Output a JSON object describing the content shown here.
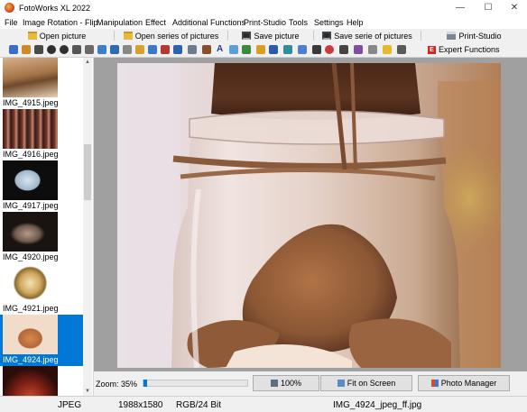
{
  "window": {
    "title": "FotoWorks XL 2022",
    "controls": [
      "—",
      "☐",
      "✕"
    ]
  },
  "menu": [
    "File",
    "Image Rotation - Flip",
    "Manipulation",
    "Effect",
    "Additional Functions",
    "Print-Studio",
    "Tools",
    "Settings",
    "Help"
  ],
  "main_toolbar": {
    "open_picture": "Open picture",
    "open_series": "Open series of pictures",
    "save_picture": "Save picture",
    "save_series": "Save serie of pictures",
    "print_studio": "Print-Studio"
  },
  "icon_toolbar": {
    "expert_letter": "E",
    "expert_label": "Expert Functions"
  },
  "thumbnails": [
    {
      "label": "IMG_4915.jpeg",
      "selected": false
    },
    {
      "label": "IMG_4916.jpeg",
      "selected": false
    },
    {
      "label": "IMG_4917.jpeg",
      "selected": false
    },
    {
      "label": "IMG_4920.jpeg",
      "selected": false
    },
    {
      "label": "IMG_4921.jpeg",
      "selected": false
    },
    {
      "label": "IMG_4924.jpeg",
      "selected": true
    },
    {
      "label": "",
      "selected": false
    }
  ],
  "scrollbar": {
    "up": "▲",
    "down": "▼"
  },
  "zoom": {
    "label": "Zoom: 35%",
    "value_percent": 35
  },
  "buttons": {
    "hundred": "100%",
    "fit": "Fit on Screen",
    "photo_manager": "Photo Manager"
  },
  "status": {
    "format": "JPEG",
    "dimensions": "1988x1580",
    "color_mode": "RGB/24 Bit",
    "filename": "IMG_4924_jpeg_ff.jpg"
  },
  "colors": {
    "selection": "#0078d7",
    "expert_red": "#d9231f"
  }
}
